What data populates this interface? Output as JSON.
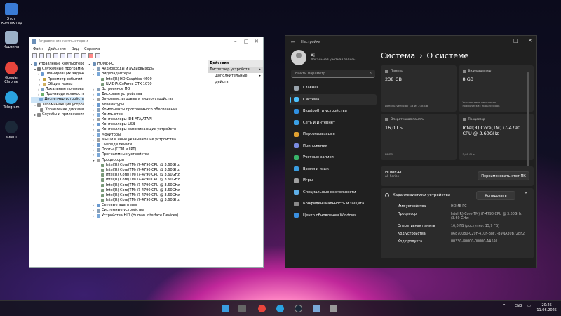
{
  "desktop": {
    "icons": [
      {
        "label": "Этот компьютер",
        "color": "#3a7bd5"
      },
      {
        "label": "Корзина",
        "color": "#9bb0c8"
      },
      {
        "label": "Google Chrome",
        "color": "#e8453c"
      },
      {
        "label": "Telegram",
        "color": "#2aa3e0"
      },
      {
        "label": "steam",
        "color": "#1b2838"
      }
    ]
  },
  "device_manager": {
    "title": "Управление компьютером",
    "menu": [
      "Файл",
      "Действие",
      "Вид",
      "Справка"
    ],
    "left_tree": [
      "Управление компьютером (л",
      "Служебные программы",
      "Планировщик заданий",
      "Просмотр событий",
      "Общие папки",
      "Локальные пользовате",
      "Производительность",
      "Диспетчер устройств",
      "Запоминающие устройств",
      "Управление дисками",
      "Службы и приложения"
    ],
    "tree": [
      "HOME-PC",
      "Аудиовходы и аудиовыходы",
      "Видеоадаптеры",
      "Intel(R) HD Graphics 4600",
      "NVIDIA GeForce GTX 1070",
      "Встроенное ПО",
      "Дисковые устройства",
      "Звуковые, игровые и видеоустройства",
      "Клавиатуры",
      "Компоненты программного обеспечения",
      "Компьютер",
      "Контроллеры IDE ATA/ATAPI",
      "Контроллеры USB",
      "Контроллеры запоминающих устройств",
      "Мониторы",
      "Мыши и иные указывающие устройства",
      "Очереди печати",
      "Порты (COM и LPT)",
      "Программные устройства",
      "Процессоры",
      "Intel(R) Core(TM) i7-4790 CPU @ 3.60GHz",
      "Intel(R) Core(TM) i7-4790 CPU @ 3.60GHz",
      "Intel(R) Core(TM) i7-4790 CPU @ 3.60GHz",
      "Intel(R) Core(TM) i7-4790 CPU @ 3.60GHz",
      "Intel(R) Core(TM) i7-4790 CPU @ 3.60GHz",
      "Intel(R) Core(TM) i7-4790 CPU @ 3.60GHz",
      "Intel(R) Core(TM) i7-4790 CPU @ 3.60GHz",
      "Intel(R) Core(TM) i7-4790 CPU @ 3.60GHz",
      "Сетевые адаптеры",
      "Системные устройства",
      "Устройства HID (Human Interface Devices)"
    ],
    "actions_header": "Действия",
    "actions": [
      "Диспетчер устройств",
      "Дополнительные действ"
    ]
  },
  "settings": {
    "window_title": "Настройки",
    "user_name": "Ai",
    "user_sub": "Локальная учетная запись",
    "search_placeholder": "Найти параметр",
    "nav": [
      {
        "label": "Главная",
        "color": "#9aa4ad"
      },
      {
        "label": "Система",
        "color": "#4cc2ff"
      },
      {
        "label": "Bluetooth и устройства",
        "color": "#2f8fe0"
      },
      {
        "label": "Сеть и Интернет",
        "color": "#3aa0e6"
      },
      {
        "label": "Персонализация",
        "color": "#e0a030"
      },
      {
        "label": "Приложения",
        "color": "#7a8ce0"
      },
      {
        "label": "Учетные записи",
        "color": "#39b46a"
      },
      {
        "label": "Время и язык",
        "color": "#3a9de0"
      },
      {
        "label": "Игры",
        "color": "#a0a0a0"
      },
      {
        "label": "Специальные возможности",
        "color": "#5fb0e8"
      },
      {
        "label": "Конфиденциальность и защита",
        "color": "#8a8a8a"
      },
      {
        "label": "Центр обновления Windows",
        "color": "#3a8fe0"
      }
    ],
    "breadcrumb_parent": "Система",
    "breadcrumb_sep": "›",
    "breadcrumb_current": "О системе",
    "cards": [
      {
        "label": "Память",
        "value": "238 GB",
        "sub": "Используется 87 GB из 238 GB"
      },
      {
        "label": "Видеоадаптер",
        "value": "8 GB",
        "sub": "Установлено несколько графических процессоров"
      },
      {
        "label": "Оперативная память",
        "value": "16,0 ГБ",
        "sub": "DDR3"
      },
      {
        "label": "Процессор",
        "value": "Intel(R) Core(TM) i7-4790 CPU @ 3.60GHz",
        "sub": "3,60 GHz"
      }
    ],
    "pc_name": "HOME-PC",
    "pc_sub": "All Series",
    "rename_button": "Переименовать этот ПК",
    "specs_title": "Характеристики устройства",
    "copy_button": "Копировать",
    "specs": [
      {
        "key": "Имя устройства",
        "value": "HOME-PC"
      },
      {
        "key": "Процессор",
        "value": "Intel(R) Core(TM) i7-4790 CPU @ 3.60GHz (3.60 GHz)"
      },
      {
        "key": "Оперативная память",
        "value": "16,0 ГБ (доступно: 15,9 ГБ)"
      },
      {
        "key": "Код устройства",
        "value": "86870080-C29F-410F-B8F7-B9NA30B72BF2"
      },
      {
        "key": "Код продукта",
        "value": "00330-80000-00000-AA591"
      }
    ]
  },
  "taskbar": {
    "lang": "ENG",
    "time": "20:25",
    "date": "11.06.2025"
  }
}
